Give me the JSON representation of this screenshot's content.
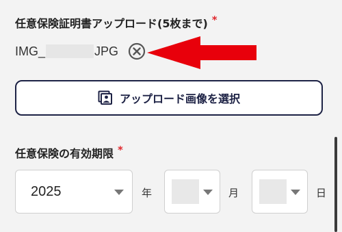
{
  "upload": {
    "label": "任意保険証明書アップロード(5枚まで)",
    "required_mark": "*",
    "file_prefix": "IMG_",
    "file_suffix": "JPG",
    "button_label": "アップロード画像を選択"
  },
  "insurance": {
    "label": "任意保険の有効期限",
    "required_mark": "*",
    "year_value": "2025",
    "year_unit": "年",
    "month_unit": "月",
    "day_unit": "日"
  },
  "colors": {
    "required": "#e0282e",
    "button_border": "#1c2144",
    "arrow": "#e8000b"
  },
  "icons": {
    "remove": "circle-x-icon",
    "upload": "image-upload-icon",
    "dropdown": "caret-down-icon"
  }
}
